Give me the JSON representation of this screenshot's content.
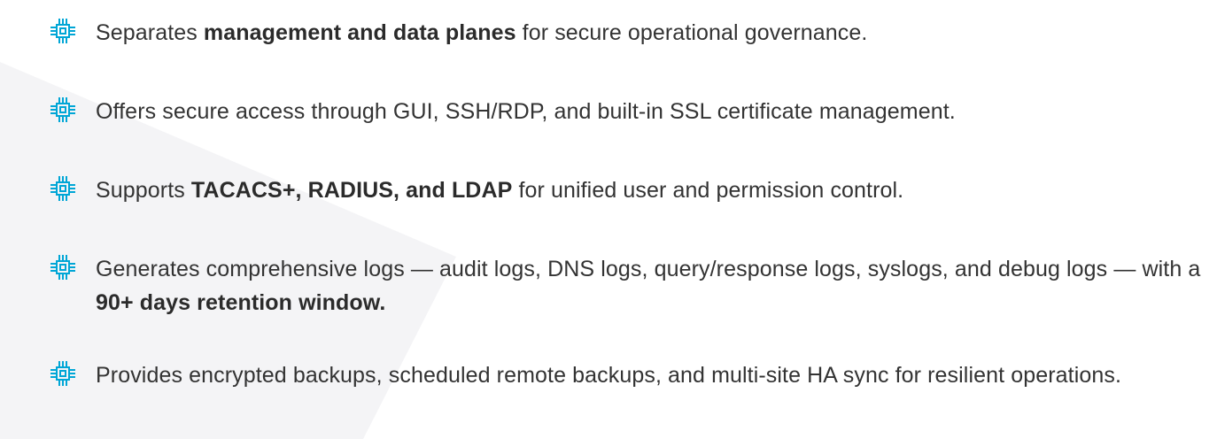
{
  "colors": {
    "icon_accent": "#00a6d6",
    "text": "#333333",
    "background_shape": "#f4f4f6"
  },
  "features": [
    {
      "icon": "chip-icon",
      "pre": "Separates ",
      "bold": "management and data planes",
      "post": " for secure operational governance."
    },
    {
      "icon": "chip-icon",
      "pre": "Offers secure access through GUI, SSH/RDP, and built-in SSL certificate management.",
      "bold": "",
      "post": ""
    },
    {
      "icon": "chip-icon",
      "pre": "Supports ",
      "bold": "TACACS+, RADIUS, and LDAP",
      "post": " for unified user and permission control."
    },
    {
      "icon": "chip-icon",
      "pre": "Generates comprehensive logs — audit logs, DNS logs, query/response logs, syslogs, and debug logs — with a  ",
      "bold": "90+ days retention window.",
      "post": ""
    },
    {
      "icon": "chip-icon",
      "pre": "Provides encrypted backups, scheduled remote backups, and multi-site HA sync for resilient operations.",
      "bold": "",
      "post": ""
    }
  ]
}
